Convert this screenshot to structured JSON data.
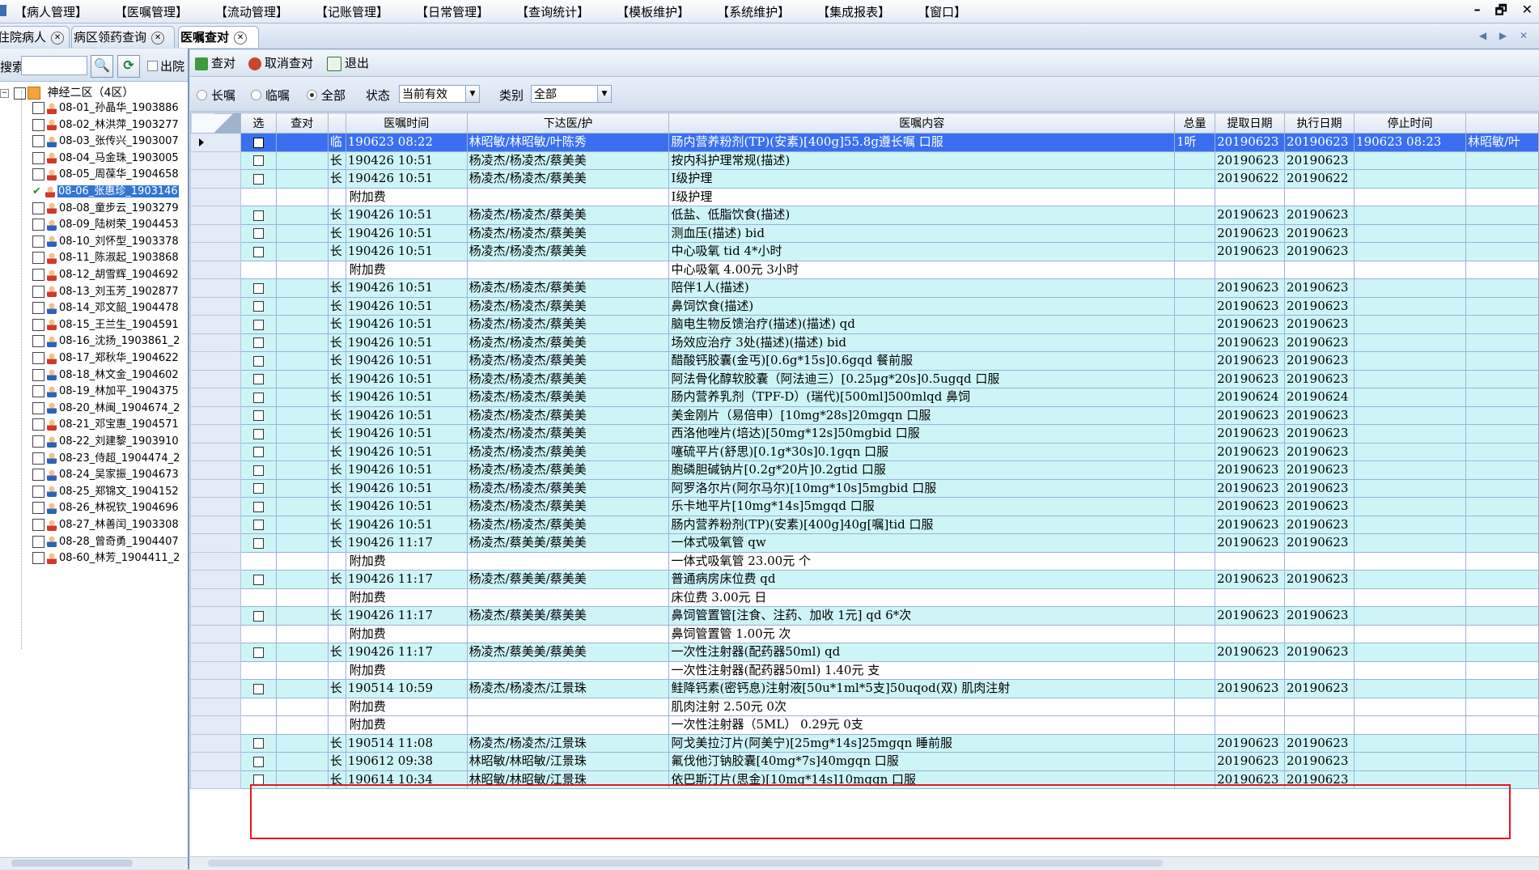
{
  "menu": [
    "【病人管理】",
    "【医嘱管理】",
    "【流动管理】",
    "【记账管理】",
    "【日常管理】",
    "【查询统计】",
    "【模板维护】",
    "【系统维护】",
    "【集成报表】",
    "【窗口】"
  ],
  "window_controls": [
    "–",
    "🗗",
    "✕"
  ],
  "tabs": [
    {
      "label": "住院病人",
      "active": false
    },
    {
      "label": "病区领药查询",
      "active": false
    },
    {
      "label": "医嘱查对",
      "active": true
    }
  ],
  "tab_nav": "◀ ▶ ✕",
  "left": {
    "search_label": "搜索:",
    "discharge_label": "出院",
    "ward": "神经二区（4区）",
    "patients": [
      {
        "label": "08-01_孙晶华_1903886",
        "g": "f"
      },
      {
        "label": "08-02_林洪萍_1903277",
        "g": "f"
      },
      {
        "label": "08-03_张传兴_1903007",
        "g": "m"
      },
      {
        "label": "08-04_马金珠_1903005",
        "g": "f"
      },
      {
        "label": "08-05_周葆华_1904658",
        "g": "f"
      },
      {
        "label": "08-06_张惠珍_1903146",
        "g": "f",
        "selected": true
      },
      {
        "label": "08-08_童步云_1903279",
        "g": "f"
      },
      {
        "label": "08-09_陆树荣_1904453",
        "g": "m"
      },
      {
        "label": "08-10_刘怀型_1903378",
        "g": "m"
      },
      {
        "label": "08-11_陈淑起_1903868",
        "g": "f"
      },
      {
        "label": "08-12_胡雪辉_1904692",
        "g": "f"
      },
      {
        "label": "08-13_刘玉芳_1902877",
        "g": "f"
      },
      {
        "label": "08-14_邓文韶_1904478",
        "g": "m"
      },
      {
        "label": "08-15_王兰生_1904591",
        "g": "f"
      },
      {
        "label": "08-16_沈扬_1903861_2",
        "g": "m"
      },
      {
        "label": "08-17_郑秋华_1904622",
        "g": "f"
      },
      {
        "label": "08-18_林文金_1904602",
        "g": "m"
      },
      {
        "label": "08-19_林加平_1904375",
        "g": "m"
      },
      {
        "label": "08-20_林闽_1904674_2",
        "g": "m"
      },
      {
        "label": "08-21_邓宝惠_1904571",
        "g": "f"
      },
      {
        "label": "08-22_刘建黎_1903910",
        "g": "m"
      },
      {
        "label": "08-23_侍超_1904474_2",
        "g": "m"
      },
      {
        "label": "08-24_吴家振_1904673",
        "g": "m"
      },
      {
        "label": "08-25_郑锦文_1904152",
        "g": "m"
      },
      {
        "label": "08-26_林祝钦_1904696",
        "g": "m"
      },
      {
        "label": "08-27_林善闰_1903308",
        "g": "f"
      },
      {
        "label": "08-28_曾奇勇_1904407",
        "g": "m"
      },
      {
        "label": "08-60_林芳_1904411_2",
        "g": "f"
      }
    ]
  },
  "toolbar": {
    "check": "查对",
    "cancel": "取消查对",
    "exit": "退出"
  },
  "filters": {
    "long": "长嘱",
    "temp": "临嘱",
    "all": "全部",
    "selected": "all",
    "status_label": "状态",
    "status_value": "当前有效",
    "type_label": "类别",
    "type_value": "全部"
  },
  "columns": [
    "选",
    "查对",
    "",
    "医嘱时间",
    "下达医/护",
    "医嘱内容",
    "总量",
    "提取日期",
    "执行日期",
    "停止时间",
    ""
  ],
  "rows": [
    {
      "k": "cur",
      "check": true,
      "type": "临",
      "time": "190623 08:22",
      "doc": "林昭敏/林昭敏/叶陈秀",
      "content": "肠内营养粉剂(TP)(安素)[400g]55.8g遵长嘱 口服",
      "qty": "1听",
      "fetch": "20190623",
      "exec": "20190623",
      "stop": "190623 08:23",
      "extra": "林昭敏/叶"
    },
    {
      "k": "main",
      "check": true,
      "type": "长",
      "time": "190426 10:51",
      "doc": "杨凌杰/杨凌杰/蔡美美",
      "content": "按内科护理常规(描述)",
      "qty": "",
      "fetch": "20190623",
      "exec": "20190623",
      "stop": "",
      "extra": ""
    },
    {
      "k": "main",
      "check": true,
      "type": "长",
      "time": "190426 10:51",
      "doc": "杨凌杰/杨凌杰/蔡美美",
      "content": "Ⅰ级护理",
      "qty": "",
      "fetch": "20190622",
      "exec": "20190622",
      "stop": "",
      "extra": ""
    },
    {
      "k": "fee",
      "check": false,
      "type": "",
      "time": "附加费",
      "doc": "",
      "content": "Ⅰ级护理",
      "qty": "",
      "fetch": "",
      "exec": "",
      "stop": "",
      "extra": ""
    },
    {
      "k": "main",
      "check": true,
      "type": "长",
      "time": "190426 10:51",
      "doc": "杨凌杰/杨凌杰/蔡美美",
      "content": "低盐、低脂饮食(描述)",
      "qty": "",
      "fetch": "20190623",
      "exec": "20190623",
      "stop": "",
      "extra": ""
    },
    {
      "k": "main",
      "check": true,
      "type": "长",
      "time": "190426 10:51",
      "doc": "杨凌杰/杨凌杰/蔡美美",
      "content": "测血压(描述) bid",
      "qty": "",
      "fetch": "20190623",
      "exec": "20190623",
      "stop": "",
      "extra": ""
    },
    {
      "k": "main",
      "check": true,
      "type": "长",
      "time": "190426 10:51",
      "doc": "杨凌杰/杨凌杰/蔡美美",
      "content": "中心吸氧 tid 4*小时",
      "qty": "",
      "fetch": "20190623",
      "exec": "20190623",
      "stop": "",
      "extra": ""
    },
    {
      "k": "fee",
      "check": false,
      "type": "",
      "time": "附加费",
      "doc": "",
      "content": "中心吸氧    4.00元 3小时",
      "qty": "",
      "fetch": "",
      "exec": "",
      "stop": "",
      "extra": ""
    },
    {
      "k": "main",
      "check": true,
      "type": "长",
      "time": "190426 10:51",
      "doc": "杨凌杰/杨凌杰/蔡美美",
      "content": "陪伴1人(描述)",
      "qty": "",
      "fetch": "20190623",
      "exec": "20190623",
      "stop": "",
      "extra": ""
    },
    {
      "k": "main",
      "check": true,
      "type": "长",
      "time": "190426 10:51",
      "doc": "杨凌杰/杨凌杰/蔡美美",
      "content": "鼻饲饮食(描述)",
      "qty": "",
      "fetch": "20190623",
      "exec": "20190623",
      "stop": "",
      "extra": ""
    },
    {
      "k": "main",
      "check": true,
      "type": "长",
      "time": "190426 10:51",
      "doc": "杨凌杰/杨凌杰/蔡美美",
      "content": "脑电生物反馈治疗(描述)(描述) qd",
      "qty": "",
      "fetch": "20190623",
      "exec": "20190623",
      "stop": "",
      "extra": ""
    },
    {
      "k": "main",
      "check": true,
      "type": "长",
      "time": "190426 10:51",
      "doc": "杨凌杰/杨凌杰/蔡美美",
      "content": "场效应治疗 3处(描述)(描述) bid",
      "qty": "",
      "fetch": "20190623",
      "exec": "20190623",
      "stop": "",
      "extra": ""
    },
    {
      "k": "main",
      "check": true,
      "type": "长",
      "time": "190426 10:51",
      "doc": "杨凌杰/杨凌杰/蔡美美",
      "content": "醋酸钙胶囊(金丐)[0.6g*15s]0.6gqd 餐前服",
      "qty": "",
      "fetch": "20190623",
      "exec": "20190623",
      "stop": "",
      "extra": ""
    },
    {
      "k": "main",
      "check": true,
      "type": "长",
      "time": "190426 10:51",
      "doc": "杨凌杰/杨凌杰/蔡美美",
      "content": "阿法骨化醇软胶囊（阿法迪三）[0.25μg*20s]0.5ugqd 口服",
      "qty": "",
      "fetch": "20190623",
      "exec": "20190623",
      "stop": "",
      "extra": ""
    },
    {
      "k": "main",
      "check": true,
      "type": "长",
      "time": "190426 10:51",
      "doc": "杨凌杰/杨凌杰/蔡美美",
      "content": "肠内营养乳剂（TPF-D）(瑞代)[500ml]500mlqd 鼻饲",
      "qty": "",
      "fetch": "20190624",
      "exec": "20190624",
      "stop": "",
      "extra": ""
    },
    {
      "k": "main",
      "check": true,
      "type": "长",
      "time": "190426 10:51",
      "doc": "杨凌杰/杨凌杰/蔡美美",
      "content": "美金刚片（易倍申）[10mg*28s]20mgqn 口服",
      "qty": "",
      "fetch": "20190623",
      "exec": "20190623",
      "stop": "",
      "extra": ""
    },
    {
      "k": "main",
      "check": true,
      "type": "长",
      "time": "190426 10:51",
      "doc": "杨凌杰/杨凌杰/蔡美美",
      "content": "西洛他唑片(培达)[50mg*12s]50mgbid 口服",
      "qty": "",
      "fetch": "20190623",
      "exec": "20190623",
      "stop": "",
      "extra": ""
    },
    {
      "k": "main",
      "check": true,
      "type": "长",
      "time": "190426 10:51",
      "doc": "杨凌杰/杨凌杰/蔡美美",
      "content": "噻硫平片(舒思)[0.1g*30s]0.1gqn 口服",
      "qty": "",
      "fetch": "20190623",
      "exec": "20190623",
      "stop": "",
      "extra": ""
    },
    {
      "k": "main",
      "check": true,
      "type": "长",
      "time": "190426 10:51",
      "doc": "杨凌杰/杨凌杰/蔡美美",
      "content": "胞磷胆碱钠片[0.2g*20片]0.2gtid 口服",
      "qty": "",
      "fetch": "20190623",
      "exec": "20190623",
      "stop": "",
      "extra": ""
    },
    {
      "k": "main",
      "check": true,
      "type": "长",
      "time": "190426 10:51",
      "doc": "杨凌杰/杨凌杰/蔡美美",
      "content": "阿罗洛尔片(阿尔马尔)[10mg*10s]5mgbid 口服",
      "qty": "",
      "fetch": "20190623",
      "exec": "20190623",
      "stop": "",
      "extra": ""
    },
    {
      "k": "main",
      "check": true,
      "type": "长",
      "time": "190426 10:51",
      "doc": "杨凌杰/杨凌杰/蔡美美",
      "content": "乐卡地平片[10mg*14s]5mgqd 口服",
      "qty": "",
      "fetch": "20190623",
      "exec": "20190623",
      "stop": "",
      "extra": ""
    },
    {
      "k": "main",
      "check": true,
      "type": "长",
      "time": "190426 10:51",
      "doc": "杨凌杰/杨凌杰/蔡美美",
      "content": "肠内营养粉剂(TP)(安素)[400g]40g[嘱]tid 口服",
      "qty": "",
      "fetch": "20190623",
      "exec": "20190623",
      "stop": "",
      "extra": ""
    },
    {
      "k": "main",
      "check": true,
      "type": "长",
      "time": "190426 11:17",
      "doc": "杨凌杰/蔡美美/蔡美美",
      "content": "一体式吸氧管 qw",
      "qty": "",
      "fetch": "20190623",
      "exec": "20190623",
      "stop": "",
      "extra": ""
    },
    {
      "k": "fee",
      "check": false,
      "type": "",
      "time": "附加费",
      "doc": "",
      "content": "一体式吸氧管    23.00元 个",
      "qty": "",
      "fetch": "",
      "exec": "",
      "stop": "",
      "extra": ""
    },
    {
      "k": "main",
      "check": true,
      "type": "长",
      "time": "190426 11:17",
      "doc": "杨凌杰/蔡美美/蔡美美",
      "content": "普通病房床位费 qd",
      "qty": "",
      "fetch": "20190623",
      "exec": "20190623",
      "stop": "",
      "extra": ""
    },
    {
      "k": "fee",
      "check": false,
      "type": "",
      "time": "附加费",
      "doc": "",
      "content": "床位费    3.00元 日",
      "qty": "",
      "fetch": "",
      "exec": "",
      "stop": "",
      "extra": ""
    },
    {
      "k": "main",
      "check": true,
      "type": "长",
      "time": "190426 11:17",
      "doc": "杨凌杰/蔡美美/蔡美美",
      "content": "鼻饲管置管[注食、注药、加收 1元] qd 6*次",
      "qty": "",
      "fetch": "20190623",
      "exec": "20190623",
      "stop": "",
      "extra": ""
    },
    {
      "k": "fee",
      "check": false,
      "type": "",
      "time": "附加费",
      "doc": "",
      "content": "鼻饲管置管    1.00元 次",
      "qty": "",
      "fetch": "",
      "exec": "",
      "stop": "",
      "extra": ""
    },
    {
      "k": "main",
      "check": true,
      "type": "长",
      "time": "190426 11:17",
      "doc": "杨凌杰/蔡美美/蔡美美",
      "content": "一次性注射器(配药器50ml) qd",
      "qty": "",
      "fetch": "20190623",
      "exec": "20190623",
      "stop": "",
      "extra": ""
    },
    {
      "k": "fee",
      "check": false,
      "type": "",
      "time": "附加费",
      "doc": "",
      "content": "一次性注射器(配药器50ml)    1.40元 支",
      "qty": "",
      "fetch": "",
      "exec": "",
      "stop": "",
      "extra": ""
    },
    {
      "k": "main",
      "check": true,
      "type": "长",
      "time": "190514 10:59",
      "doc": "杨凌杰/杨凌杰/江景珠",
      "content": "鲑降钙素(密钙息)注射液[50u*1ml*5支]50uqod(双) 肌肉注射",
      "qty": "",
      "fetch": "20190623",
      "exec": "20190623",
      "stop": "",
      "extra": ""
    },
    {
      "k": "fee",
      "check": false,
      "type": "",
      "time": "附加费",
      "doc": "",
      "content": "肌肉注射    2.50元 0次",
      "qty": "",
      "fetch": "",
      "exec": "",
      "stop": "",
      "extra": ""
    },
    {
      "k": "fee",
      "check": false,
      "type": "",
      "time": "附加费",
      "doc": "",
      "content": "一次性注射器（5ML）    0.29元 0支",
      "qty": "",
      "fetch": "",
      "exec": "",
      "stop": "",
      "extra": ""
    },
    {
      "k": "main",
      "check": true,
      "type": "长",
      "time": "190514 11:08",
      "doc": "杨凌杰/杨凌杰/江景珠",
      "content": "阿戈美拉汀片(阿美宁)[25mg*14s]25mgqn 睡前服",
      "qty": "",
      "fetch": "20190623",
      "exec": "20190623",
      "stop": "",
      "extra": ""
    },
    {
      "k": "main",
      "check": true,
      "type": "长",
      "time": "190612 09:38",
      "doc": "林昭敏/林昭敏/江景珠",
      "content": "氟伐他汀钠胶囊[40mg*7s]40mgqn 口服",
      "qty": "",
      "fetch": "20190623",
      "exec": "20190623",
      "stop": "",
      "extra": ""
    },
    {
      "k": "main",
      "check": true,
      "type": "长",
      "time": "190614 10:34",
      "doc": "林昭敏/林昭敏/江景珠",
      "content": "依巴斯汀片(思金)[10mg*14s]10mgqn 口服",
      "qty": "",
      "fetch": "20190623",
      "exec": "20190623",
      "stop": "",
      "extra": ""
    }
  ],
  "colors": {
    "row_main": "#cdf5f8",
    "row_selected": "#3a6ff0",
    "highlight_box": "#e8161a"
  }
}
